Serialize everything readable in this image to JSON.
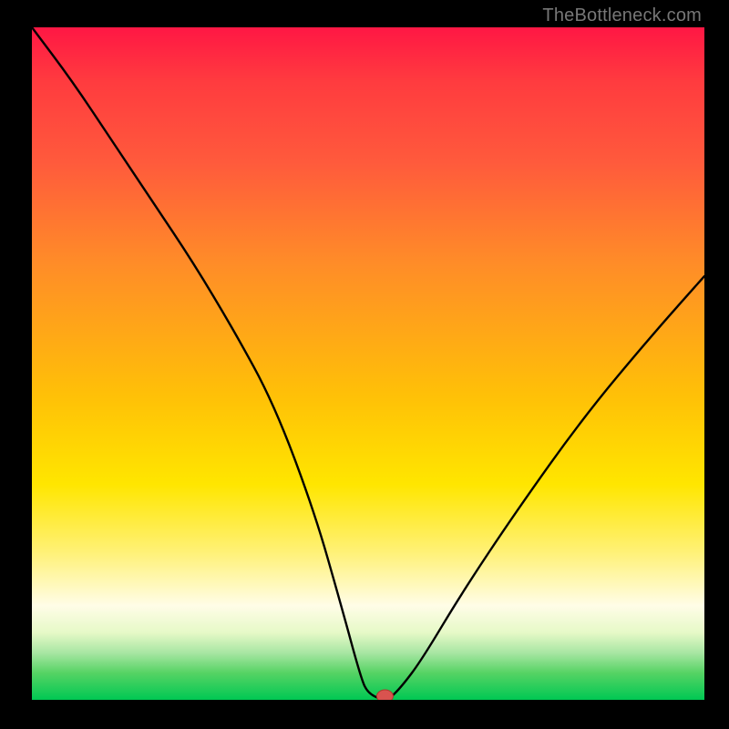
{
  "watermark": "TheBottleneck.com",
  "chart_data": {
    "type": "line",
    "title": "",
    "xlabel": "",
    "ylabel": "",
    "xlim": [
      0,
      100
    ],
    "ylim": [
      0,
      100
    ],
    "series": [
      {
        "name": "bottleneck-curve",
        "x": [
          0,
          6,
          12,
          18,
          24,
          30,
          36,
          42,
          46,
          49,
          50,
          52,
          53,
          55,
          58,
          64,
          72,
          82,
          92,
          100
        ],
        "y": [
          100,
          92,
          83,
          74,
          65,
          55,
          44,
          28,
          14,
          3,
          1,
          0,
          0,
          2,
          6,
          16,
          28,
          42,
          54,
          63
        ]
      }
    ],
    "marker": {
      "x": 52.5,
      "y": 0,
      "label": "optimal-point"
    },
    "background": {
      "gradient_stops": [
        {
          "pos": 0,
          "color": "#ff1744"
        },
        {
          "pos": 20,
          "color": "#ff5a3c"
        },
        {
          "pos": 55,
          "color": "#ffc107"
        },
        {
          "pos": 80,
          "color": "#fff176"
        },
        {
          "pos": 90,
          "color": "#e6f9c7"
        },
        {
          "pos": 100,
          "color": "#00c853"
        }
      ]
    }
  }
}
